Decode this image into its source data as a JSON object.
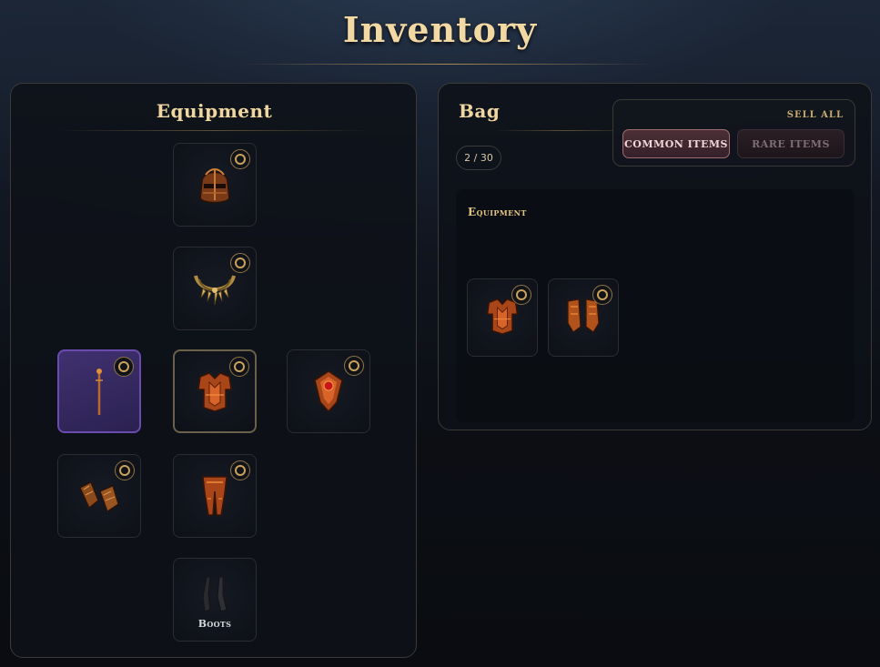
{
  "title": "Inventory",
  "equipment_panel": {
    "title": "Equipment",
    "slots": [
      {
        "slot": "head",
        "icon": "helmet-icon",
        "label": "",
        "equipped": true
      },
      {
        "slot": "neck",
        "icon": "necklace-icon",
        "label": "",
        "equipped": true
      },
      {
        "slot": "main-hand",
        "icon": "staff-icon",
        "label": "",
        "equipped": true,
        "rarity_color": "#6a4bb0"
      },
      {
        "slot": "chest",
        "icon": "chest-armor-icon",
        "label": "",
        "equipped": true
      },
      {
        "slot": "off-hand",
        "icon": "shield-icon",
        "label": "",
        "equipped": true
      },
      {
        "slot": "hands",
        "icon": "gauntlets-icon",
        "label": "",
        "equipped": true
      },
      {
        "slot": "legs",
        "icon": "leg-armor-icon",
        "label": "",
        "equipped": true
      },
      {
        "slot": "feet",
        "icon": "boots-icon",
        "label": "Boots",
        "equipped": false
      }
    ]
  },
  "bag_panel": {
    "title": "Bag",
    "count": "2 / 30",
    "sell": {
      "sell_all_label": "SELL ALL",
      "common_label": "COMMON ITEMS",
      "rare_label": "RARE ITEMS"
    },
    "section_label": "Equipment",
    "items": [
      {
        "icon": "chest-armor-icon"
      },
      {
        "icon": "gauntlets-icon"
      }
    ]
  },
  "colors": {
    "accent_gold": "#f0d7a1",
    "weapon_rarity": "#6a4bb0",
    "common_btn": "#9e6d72"
  }
}
